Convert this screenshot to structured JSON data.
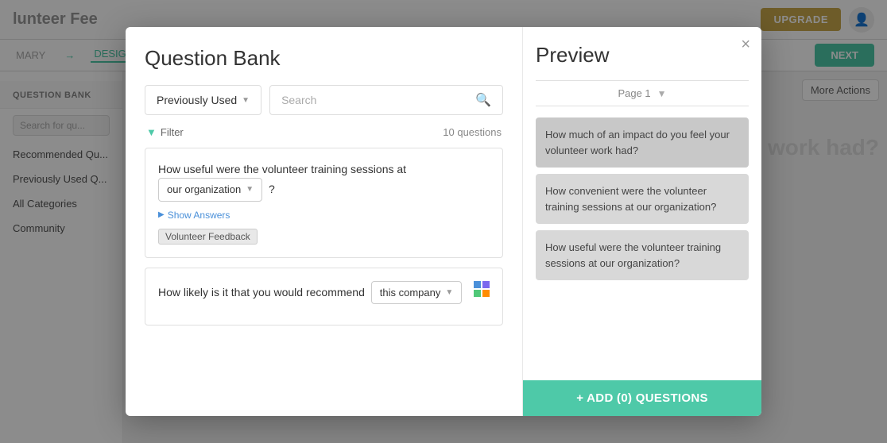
{
  "app": {
    "title": "lunteer Fee",
    "upgrade_label": "UPGRADE",
    "next_label": "NEXT",
    "more_actions_label": "More Actions",
    "bg_text": "eer work had?",
    "nav": {
      "summary": "MARY",
      "arrow": "→",
      "design": "DESIGN S"
    },
    "sidebar": {
      "bank_label": "QUESTION BANK",
      "search_placeholder": "Search for qu...",
      "items": [
        "Recommended Qu...",
        "Previously Used Q...",
        "All Categories",
        "Community"
      ]
    }
  },
  "modal": {
    "close_label": "×",
    "left": {
      "title": "Question Bank",
      "filter_button": "Previously Used",
      "search_placeholder": "Search",
      "filter_label": "Filter",
      "question_count": "10 questions",
      "questions": [
        {
          "id": "q1",
          "text_before": "How useful were the volunteer training sessions at",
          "inline_text": "our organization",
          "text_after": "?",
          "show_answers": "Show Answers",
          "tag": "Volunteer Feedback"
        },
        {
          "id": "q2",
          "text_before": "How likely is it that you would recommend",
          "inline_text": "this company",
          "text_after": "",
          "has_icon": true
        }
      ]
    },
    "right": {
      "title": "Preview",
      "page_label": "Page 1",
      "preview_questions": [
        "How much of an impact do you feel your volunteer work had?",
        "How convenient were the volunteer training sessions at our organization?",
        "How useful were the volunteer training sessions at our organization?"
      ],
      "add_button": "+ ADD (0) QUESTIONS"
    }
  }
}
